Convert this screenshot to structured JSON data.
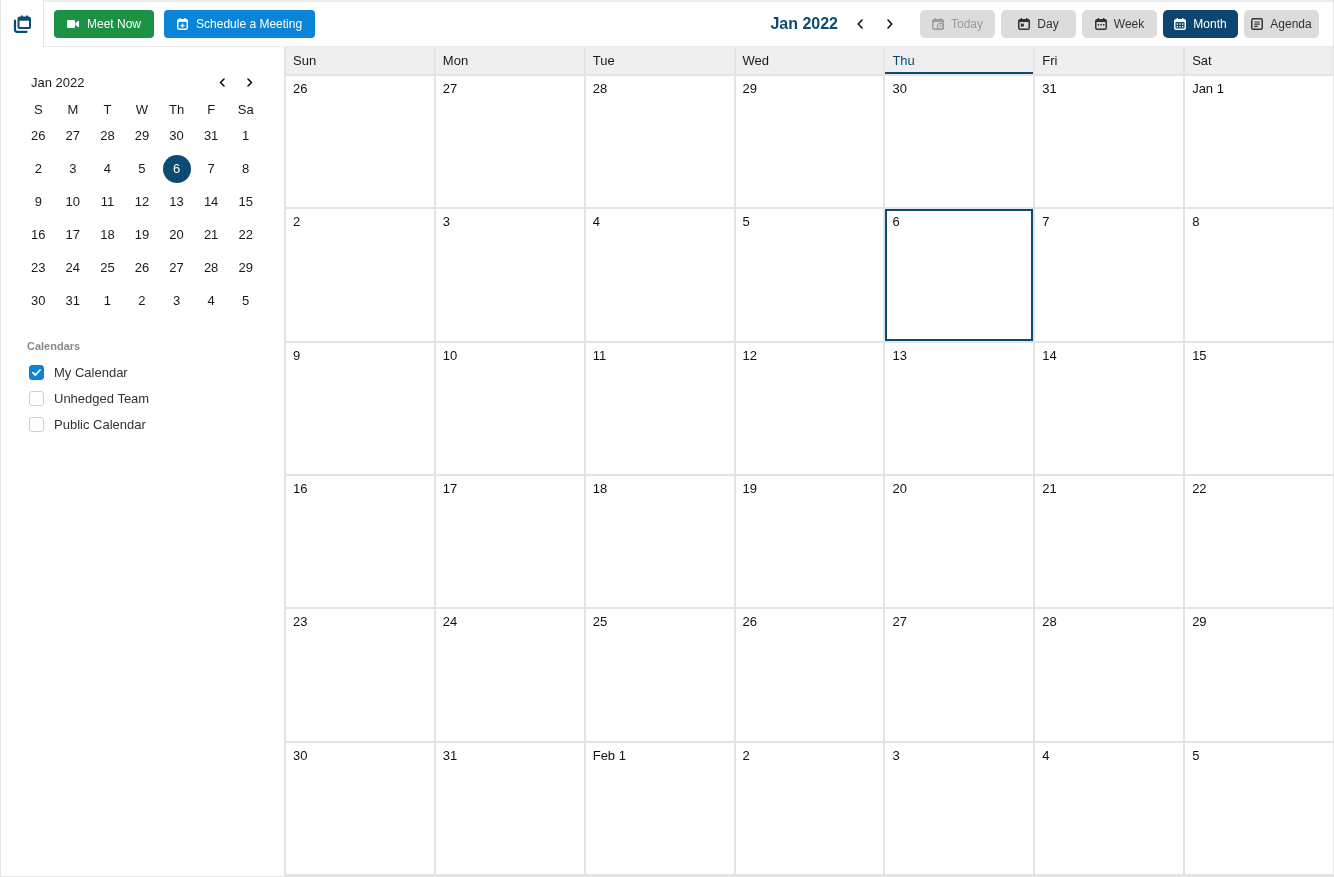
{
  "toolbar": {
    "actions": [
      {
        "kind": "meet",
        "label": "Meet Now"
      },
      {
        "kind": "schedule",
        "label": "Schedule a Meeting"
      }
    ],
    "period_title": "Jan 2022",
    "views": [
      {
        "kind": "today",
        "label": "Today",
        "disabled": true,
        "selected": false
      },
      {
        "kind": "day",
        "label": "Day",
        "disabled": false,
        "selected": false
      },
      {
        "kind": "week",
        "label": "Week",
        "disabled": false,
        "selected": false
      },
      {
        "kind": "month",
        "label": "Month",
        "disabled": false,
        "selected": true
      },
      {
        "kind": "agenda",
        "label": "Agenda",
        "disabled": false,
        "selected": false
      }
    ]
  },
  "mini_calendar": {
    "title": "Jan 2022",
    "weekdays": [
      "S",
      "M",
      "T",
      "W",
      "Th",
      "F",
      "Sa"
    ],
    "weeks": [
      [
        {
          "day": "26",
          "selected": false
        },
        {
          "day": "27",
          "selected": false
        },
        {
          "day": "28",
          "selected": false
        },
        {
          "day": "29",
          "selected": false
        },
        {
          "day": "30",
          "selected": false
        },
        {
          "day": "31",
          "selected": false
        },
        {
          "day": "1",
          "selected": false
        }
      ],
      [
        {
          "day": "2",
          "selected": false
        },
        {
          "day": "3",
          "selected": false
        },
        {
          "day": "4",
          "selected": false
        },
        {
          "day": "5",
          "selected": false
        },
        {
          "day": "6",
          "selected": true
        },
        {
          "day": "7",
          "selected": false
        },
        {
          "day": "8",
          "selected": false
        }
      ],
      [
        {
          "day": "9",
          "selected": false
        },
        {
          "day": "10",
          "selected": false
        },
        {
          "day": "11",
          "selected": false
        },
        {
          "day": "12",
          "selected": false
        },
        {
          "day": "13",
          "selected": false
        },
        {
          "day": "14",
          "selected": false
        },
        {
          "day": "15",
          "selected": false
        }
      ],
      [
        {
          "day": "16",
          "selected": false
        },
        {
          "day": "17",
          "selected": false
        },
        {
          "day": "18",
          "selected": false
        },
        {
          "day": "19",
          "selected": false
        },
        {
          "day": "20",
          "selected": false
        },
        {
          "day": "21",
          "selected": false
        },
        {
          "day": "22",
          "selected": false
        }
      ],
      [
        {
          "day": "23",
          "selected": false
        },
        {
          "day": "24",
          "selected": false
        },
        {
          "day": "25",
          "selected": false
        },
        {
          "day": "26",
          "selected": false
        },
        {
          "day": "27",
          "selected": false
        },
        {
          "day": "28",
          "selected": false
        },
        {
          "day": "29",
          "selected": false
        }
      ],
      [
        {
          "day": "30",
          "selected": false
        },
        {
          "day": "31",
          "selected": false
        },
        {
          "day": "1",
          "selected": false
        },
        {
          "day": "2",
          "selected": false
        },
        {
          "day": "3",
          "selected": false
        },
        {
          "day": "4",
          "selected": false
        },
        {
          "day": "5",
          "selected": false
        }
      ]
    ]
  },
  "calendars": {
    "heading": "Calendars",
    "items": [
      {
        "label": "My Calendar",
        "checked": true
      },
      {
        "label": "Unhedged Team",
        "checked": false
      },
      {
        "label": "Public Calendar",
        "checked": false
      }
    ]
  },
  "month_view": {
    "weekdays": [
      {
        "label": "Sun",
        "today": false
      },
      {
        "label": "Mon",
        "today": false
      },
      {
        "label": "Tue",
        "today": false
      },
      {
        "label": "Wed",
        "today": false
      },
      {
        "label": "Thu",
        "today": true
      },
      {
        "label": "Fri",
        "today": false
      },
      {
        "label": "Sat",
        "today": false
      }
    ],
    "weeks": [
      [
        {
          "date": "26",
          "today": false
        },
        {
          "date": "27",
          "today": false
        },
        {
          "date": "28",
          "today": false
        },
        {
          "date": "29",
          "today": false
        },
        {
          "date": "30",
          "today": false
        },
        {
          "date": "31",
          "today": false
        },
        {
          "date": "Jan 1",
          "today": false
        }
      ],
      [
        {
          "date": "2",
          "today": false
        },
        {
          "date": "3",
          "today": false
        },
        {
          "date": "4",
          "today": false
        },
        {
          "date": "5",
          "today": false
        },
        {
          "date": "6",
          "today": true
        },
        {
          "date": "7",
          "today": false
        },
        {
          "date": "8",
          "today": false
        }
      ],
      [
        {
          "date": "9",
          "today": false
        },
        {
          "date": "10",
          "today": false
        },
        {
          "date": "11",
          "today": false
        },
        {
          "date": "12",
          "today": false
        },
        {
          "date": "13",
          "today": false
        },
        {
          "date": "14",
          "today": false
        },
        {
          "date": "15",
          "today": false
        }
      ],
      [
        {
          "date": "16",
          "today": false
        },
        {
          "date": "17",
          "today": false
        },
        {
          "date": "18",
          "today": false
        },
        {
          "date": "19",
          "today": false
        },
        {
          "date": "20",
          "today": false
        },
        {
          "date": "21",
          "today": false
        },
        {
          "date": "22",
          "today": false
        }
      ],
      [
        {
          "date": "23",
          "today": false
        },
        {
          "date": "24",
          "today": false
        },
        {
          "date": "25",
          "today": false
        },
        {
          "date": "26",
          "today": false
        },
        {
          "date": "27",
          "today": false
        },
        {
          "date": "28",
          "today": false
        },
        {
          "date": "29",
          "today": false
        }
      ],
      [
        {
          "date": "30",
          "today": false
        },
        {
          "date": "31",
          "today": false
        },
        {
          "date": "Feb 1",
          "today": false
        },
        {
          "date": "2",
          "today": false
        },
        {
          "date": "3",
          "today": false
        },
        {
          "date": "4",
          "today": false
        },
        {
          "date": "5",
          "today": false
        }
      ]
    ]
  }
}
